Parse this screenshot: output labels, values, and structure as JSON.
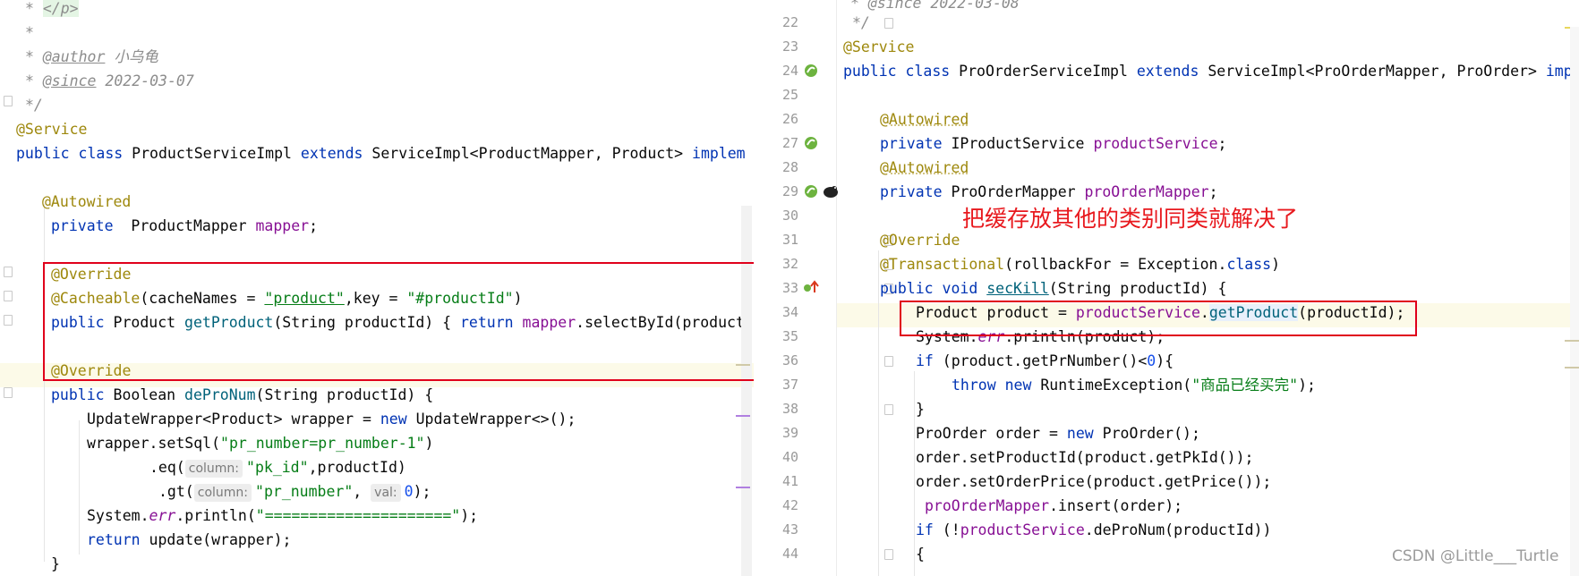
{
  "left_editor": {
    "comment_close_tag": "</p>",
    "comment_star": "*",
    "author_tag": "@author",
    "author_name": "小乌龟",
    "since_tag": "@since",
    "since_date": "2022-03-07",
    "comment_end": "*/",
    "service_annotation": "@Service",
    "class_decl": {
      "kw1": "public class",
      "name": "ProductServiceImpl",
      "kw2": "extends",
      "rest": "ServiceImpl<ProductMapper, Product>",
      "kw3": "implem"
    },
    "autowired": "@Autowired",
    "field_line": {
      "kw": "private",
      "type": "ProductMapper",
      "name": "mapper",
      "end": ";"
    },
    "override_1": "@Override",
    "cacheable": {
      "ann": "@Cacheable",
      "p1": "(cacheNames = ",
      "s1": "\"product\"",
      "p2": ",key = ",
      "s2": "\"#productId\"",
      "p3": ")"
    },
    "get_product": {
      "kw": "public",
      "type": "Product",
      "name": "getProduct",
      "params": "(String productId) {",
      "ret": "return",
      "field": "mapper",
      "call": ".selectById(product"
    },
    "override_2": "@Override",
    "de_pro_num": {
      "kw": "public",
      "type": "Boolean",
      "name": "deProNum",
      "params": "(String productId) {"
    },
    "wrapper_decl": {
      "p1": "UpdateWrapper<Product> wrapper = ",
      "kw": "new",
      "p2": "UpdateWrapper<>();"
    },
    "set_sql": {
      "p1": "wrapper.setSql(",
      "s": "\"pr_number=pr_number-1\"",
      "p2": ")"
    },
    "eq_line": {
      "p1": ".eq(",
      "hint": "column:",
      "s": "\"pk_id\"",
      "p2": ",productId)"
    },
    "gt_line": {
      "p1": ".gt(",
      "hint1": "column:",
      "s": "\"pr_number\"",
      "p2": ",",
      "hint2": "val:",
      "n": "0",
      "p3": ");"
    },
    "println": {
      "p1": "System.",
      "err": "err",
      "p2": ".println(",
      "s": "\"=====================\"",
      "p3": ");"
    },
    "return_line": {
      "kw": "return",
      "rest": "update(wrapper);"
    },
    "close_brace": "}"
  },
  "right_editor": {
    "line_numbers": [
      "22",
      "23",
      "24",
      "25",
      "26",
      "27",
      "28",
      "29",
      "30",
      "31",
      "32",
      "33",
      "34",
      "35",
      "36",
      "37",
      "38",
      "39",
      "40",
      "41",
      "42",
      "43",
      "44"
    ],
    "since_partial": "* @since 2022-03-08",
    "comment_end": "*/",
    "service_annotation": "@Service",
    "class_decl": {
      "kw1": "public class",
      "name": "ProOrderServiceImpl",
      "kw2": "extends",
      "rest": "ServiceImpl<ProOrderMapper, ProOrder>",
      "kw3": "imp"
    },
    "autowired_1": "@Autowired",
    "field_1": {
      "kw": "private",
      "type": "IProductService",
      "name": "productService",
      "end": ";"
    },
    "autowired_2": "@Autowired",
    "field_2": {
      "kw": "private",
      "type": "ProOrderMapper",
      "name": "proOrderMapper",
      "end": ";"
    },
    "override": "@Override",
    "transactional": {
      "ann": "@Transactional",
      "p1": "(rollbackFor = Exception.",
      "kw": "class",
      "p2": ")"
    },
    "sec_kill": {
      "kw": "public void",
      "name": "secKill",
      "params": "(String productId) {"
    },
    "product_line": {
      "p1": "Product product = ",
      "f": "productService",
      "dot": ".",
      "m": "getProduct",
      "p2": "(productId);"
    },
    "err_line": {
      "p1": "System.",
      "err": "err",
      "p2": ".println(product);"
    },
    "if_line": {
      "kw": "if",
      "p1": " (product.getPrNumber()<",
      "n": "0",
      "p2": "){"
    },
    "throw_line": {
      "kw": "throw new",
      "p1": " RuntimeException(",
      "s": "\"商品已经买完\"",
      "p2": ");"
    },
    "close_1": "}",
    "order_new": {
      "p1": "ProOrder order = ",
      "kw": "new",
      "p2": " ProOrder();"
    },
    "set_product_id": "order.setProductId(product.getPkId());",
    "set_order_price": "order.setOrderPrice(product.getPrice());",
    "insert_line": {
      "f": "proOrderMapper",
      "rest": ".insert(order);"
    },
    "if_de": {
      "kw": "if",
      "p1": " (!",
      "f": "productService",
      "p2": ".deProNum(productId))"
    },
    "open_brace": "{"
  },
  "annotation_note": "把缓存放其他的类别同类就解决了",
  "watermark": "CSDN @Little___Turtle",
  "colors": {
    "keyword": "#0033b3",
    "annotation": "#9e880d",
    "string": "#067d17",
    "field": "#871094",
    "red_box": "#e0001b"
  }
}
